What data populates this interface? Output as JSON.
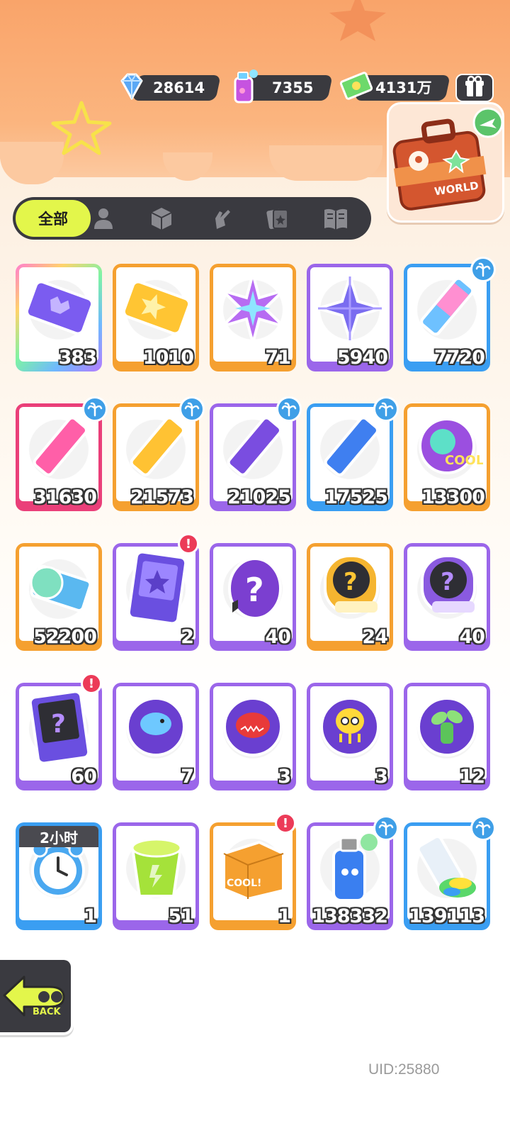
{
  "currencies": [
    {
      "name": "diamond",
      "icon": "diamond-icon",
      "value": "28614"
    },
    {
      "name": "spray-can",
      "icon": "spray-can-icon",
      "value": "7355"
    },
    {
      "name": "cash",
      "icon": "cash-icon",
      "value": "4131万"
    }
  ],
  "tabs": {
    "active_label": "全部",
    "icons": [
      "person-icon",
      "box-icon",
      "gesture-icon",
      "cards-icon",
      "book-icon"
    ]
  },
  "items": [
    {
      "icon": "purple-ticket-icon",
      "border": "rainbow",
      "count": "383"
    },
    {
      "icon": "gold-ticket-icon",
      "border": "orange",
      "count": "1010"
    },
    {
      "icon": "rainbow-star-icon",
      "border": "orange",
      "count": "71"
    },
    {
      "icon": "purple-star-icon",
      "border": "purple",
      "count": "5940"
    },
    {
      "icon": "rainbow-crayon-icon",
      "border": "blue",
      "count": "7720",
      "badge": "palm"
    },
    {
      "icon": "pink-crayon-icon",
      "border": "pink",
      "count": "31630",
      "badge": "palm"
    },
    {
      "icon": "yellow-crayon-icon",
      "border": "orange",
      "count": "21573",
      "badge": "palm"
    },
    {
      "icon": "purple-crayon-icon",
      "border": "purple",
      "count": "21025",
      "badge": "palm"
    },
    {
      "icon": "blue-crayon-icon",
      "border": "blue",
      "count": "17525",
      "badge": "palm"
    },
    {
      "icon": "cool-orb-icon",
      "border": "orange",
      "count": "13300"
    },
    {
      "icon": "season-ticket-icon",
      "border": "orange",
      "count": "52200"
    },
    {
      "icon": "travel-card-icon",
      "border": "purple",
      "count": "2",
      "badge": "alert"
    },
    {
      "icon": "mystery-egg-icon",
      "border": "purple",
      "count": "40"
    },
    {
      "icon": "deity-gold-coin-icon",
      "border": "orange",
      "count": "24"
    },
    {
      "icon": "deity-purple-coin-icon",
      "border": "purple",
      "count": "40"
    },
    {
      "icon": "mystery-travel-card-icon",
      "border": "purple",
      "count": "60",
      "badge": "alert"
    },
    {
      "icon": "fish-pet-orb-icon",
      "border": "purple",
      "count": "7"
    },
    {
      "icon": "piranha-pet-orb-icon",
      "border": "purple",
      "count": "3"
    },
    {
      "icon": "jellyfish-pet-orb-icon",
      "border": "purple",
      "count": "3"
    },
    {
      "icon": "plant-pet-orb-icon",
      "border": "purple",
      "count": "12"
    },
    {
      "icon": "alarm-clock-icon",
      "border": "blue",
      "count": "1",
      "timer": "2小时"
    },
    {
      "icon": "open-cup-icon",
      "border": "purple",
      "count": "51"
    },
    {
      "icon": "cool-box-icon",
      "border": "orange",
      "count": "1",
      "badge": "alert"
    },
    {
      "icon": "spray-can-item-icon",
      "border": "purple",
      "count": "138332",
      "badge": "palm"
    },
    {
      "icon": "paint-tube-icon",
      "border": "blue",
      "count": "139113",
      "badge": "palm"
    }
  ],
  "back_label": "BACK",
  "world_label": "WORLD",
  "uid": "UID:25880",
  "colors": {
    "accent": "#e3f64b",
    "header": "#f9a46a",
    "dark": "#3a3a40",
    "orange": "#f5a030",
    "purple": "#9b66ea",
    "blue": "#3a9ef2",
    "pink": "#ea3f79"
  }
}
